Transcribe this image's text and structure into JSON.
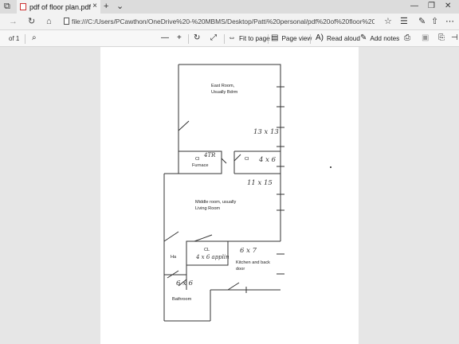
{
  "tab": {
    "title": "pdf of floor plan.pdf",
    "close": "×"
  },
  "strip": {
    "new_tab": "+",
    "tab_menu": "⌄",
    "minimize": "—",
    "maximize": "❐",
    "close": "✕"
  },
  "address": {
    "url": "file:///C:/Users/PCawthon/OneDrive%20-%20MBMS/Desktop/Patti%20personal/pdf%20of%20floor%20plan.pdf"
  },
  "pdf_toolbar": {
    "page_of": "of 1",
    "fit_label": "Fit to page",
    "page_view_label": "Page view",
    "read_aloud_label": "Read aloud",
    "add_notes_label": "Add notes"
  },
  "plan": {
    "east_room_1": "East Room,",
    "east_room_2": "Usually Bdrm",
    "cl_furnace_1": "Cl",
    "cl_furnace_2": "Furnace",
    "cl_right": "Cl",
    "middle_1": "Middle room, usually",
    "middle_2": "Living Room",
    "ha": "Ha",
    "cl_small": "CL",
    "kitchen_1": "Kitchen and back",
    "kitchen_2": "door",
    "bathroom": "Bathroom",
    "hw_13x13": "13 x 13",
    "hw_4x6": "4 x 6",
    "hw_11x15": "11 x 15",
    "hw_6x7": "6 x 7",
    "hw_4x6_applin": "4 x 6 applin",
    "hw_6x6": "6 x 6",
    "hw_4tr": "4TR"
  }
}
